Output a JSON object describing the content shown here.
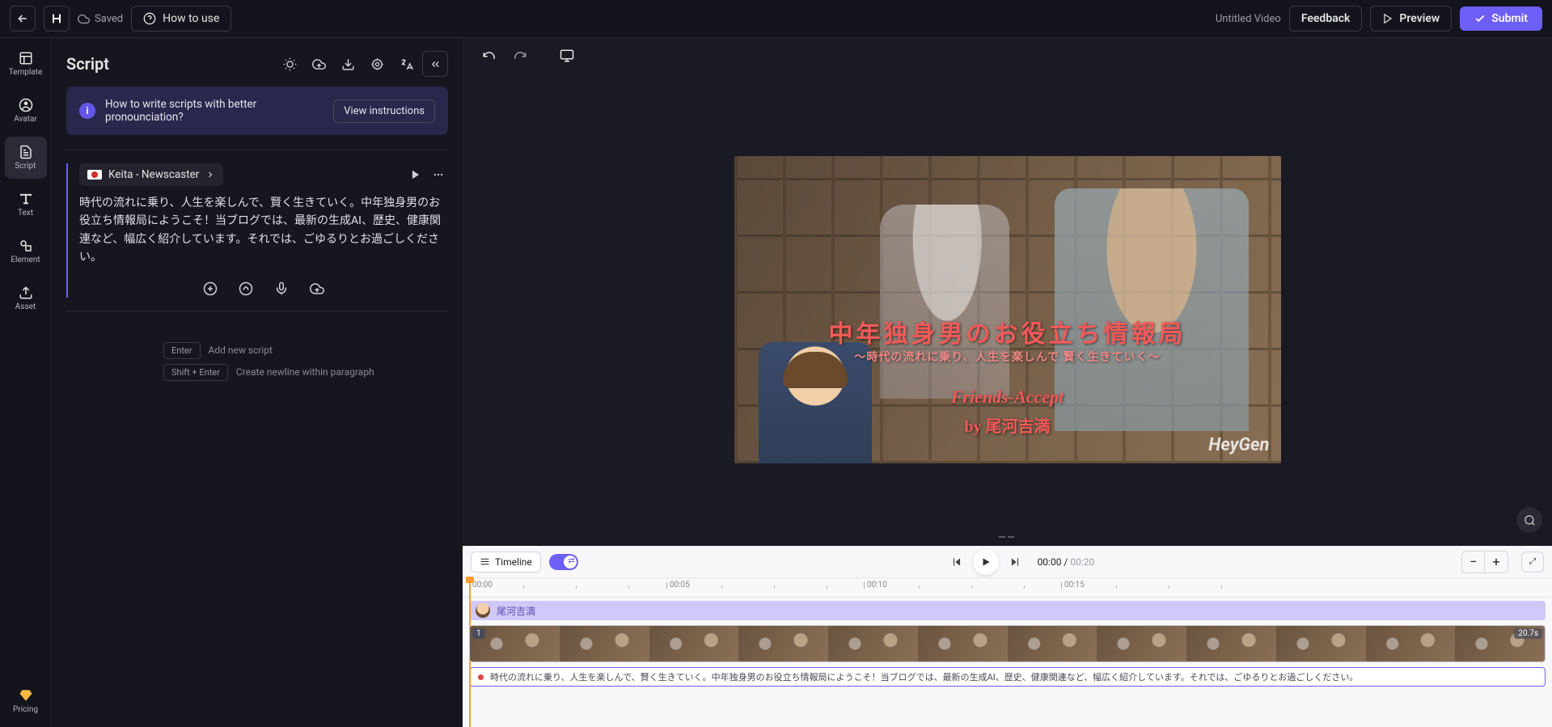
{
  "header": {
    "saved": "Saved",
    "howto": "How to use",
    "untitled": "Untitled Video",
    "feedback": "Feedback",
    "preview": "Preview",
    "submit": "Submit"
  },
  "rail": {
    "template": "Template",
    "avatar": "Avatar",
    "script": "Script",
    "text": "Text",
    "element": "Element",
    "asset": "Asset",
    "pricing": "Pricing"
  },
  "panel": {
    "title": "Script",
    "banner_text": "How to write scripts with better pronounciation?",
    "view_instructions": "View instructions",
    "voice_name": "Keita - Newscaster",
    "script_text": "時代の流れに乗り、人生を楽しんで、賢く生きていく。中年独身男のお役立ち情報局にようこそ！当ブログでは、最新の生成AI、歴史、健康関連など、幅広く紹介しています。それでは、ごゆるりとお過ごしください。",
    "hints": {
      "enter_key": "Enter",
      "enter_txt": "Add new script",
      "shift_key": "Shift + Enter",
      "shift_txt": "Create newline within paragraph"
    }
  },
  "preview": {
    "title_main": "中年独身男のお役立ち情報局",
    "subtitle": "〜時代の流れに乗り、人生を楽しんで 賢く生きていく〜",
    "friends": "Friends-Accept",
    "by": "by  尾河吉満",
    "watermark": "HeyGen"
  },
  "timeline": {
    "label": "Timeline",
    "cur": "00:00",
    "dur": "00:20",
    "marks": [
      "00:00",
      "00:05",
      "00:10",
      "00:15"
    ],
    "avatar_name": "尾河吉満",
    "clip_num": "1",
    "clip_dur": "20.7s",
    "audio_text": "時代の流れに乗り、人生を楽しんで、賢く生きていく。中年独身男のお役立ち情報局にようこそ！当ブログでは、最新の生成AI、歴史、健康関連など、幅広く紹介しています。それでは、ごゆるりとお過ごしください。"
  }
}
